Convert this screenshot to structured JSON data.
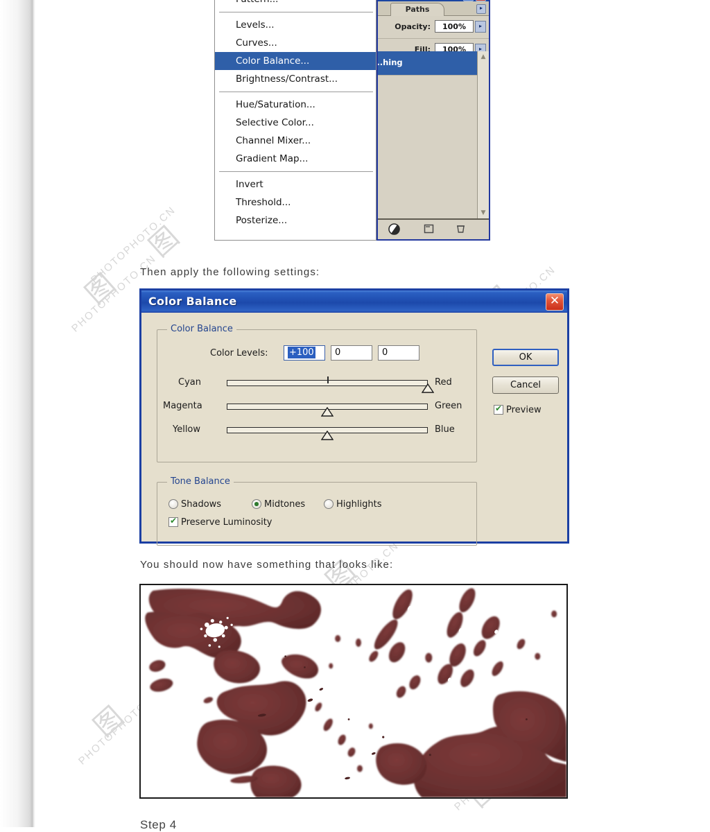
{
  "document": {
    "tutorial_steps": {
      "instruction_1": "Then apply the following settings:",
      "instruction_2": "You should now have something that looks like:",
      "next_step_heading": "Step 4"
    },
    "watermark": {
      "text": "PHOTOPHOTO.CN",
      "logo_glyph": "图"
    }
  },
  "photoshop_menu": {
    "name": "adjustment-layer-menu",
    "items": [
      {
        "label": "Pattern...",
        "selected": false,
        "separator_after": true
      },
      {
        "label": "Levels...",
        "selected": false,
        "separator_after": false
      },
      {
        "label": "Curves...",
        "selected": false,
        "separator_after": false
      },
      {
        "label": "Color Balance...",
        "selected": true,
        "separator_after": false
      },
      {
        "label": "Brightness/Contrast...",
        "selected": false,
        "separator_after": true
      },
      {
        "label": "Hue/Saturation...",
        "selected": false,
        "separator_after": false
      },
      {
        "label": "Selective Color...",
        "selected": false,
        "separator_after": false
      },
      {
        "label": "Channel Mixer...",
        "selected": false,
        "separator_after": false
      },
      {
        "label": "Gradient Map...",
        "selected": false,
        "separator_after": true
      },
      {
        "label": "Invert",
        "selected": false,
        "separator_after": false
      },
      {
        "label": "Threshold...",
        "selected": false,
        "separator_after": false
      },
      {
        "label": "Posterize...",
        "selected": false,
        "separator_after": false
      }
    ]
  },
  "layers_palette": {
    "tab_label": "Paths",
    "menu_arrow_glyph": "▸",
    "minimize_glyph": "_",
    "close_glyph": "✕",
    "opacity": {
      "label": "Opacity:",
      "value": "100%",
      "arrow_glyph": "▸"
    },
    "fill": {
      "label": "Fill:",
      "value": "100%",
      "arrow_glyph": "▸"
    },
    "selected_layer_name": "...hing",
    "scroll_up_glyph": "▲",
    "scroll_down_glyph": "▼",
    "bottom_icons": [
      "adjustment-layer-icon",
      "new-layer-icon",
      "delete-layer-icon"
    ]
  },
  "color_balance_dialog": {
    "title": "Color Balance",
    "close_glyph": "✕",
    "color_balance_group": {
      "legend": "Color Balance",
      "color_levels_label": "Color Levels:",
      "levels": [
        "+100",
        "0",
        "0"
      ],
      "sliders": [
        {
          "left": "Cyan",
          "right": "Red",
          "value": 100
        },
        {
          "left": "Magenta",
          "right": "Green",
          "value": 0
        },
        {
          "left": "Yellow",
          "right": "Blue",
          "value": 0
        }
      ]
    },
    "tone_balance_group": {
      "legend": "Tone Balance",
      "options": [
        {
          "label": "Shadows",
          "checked": false
        },
        {
          "label": "Midtones",
          "checked": true
        },
        {
          "label": "Highlights",
          "checked": false
        }
      ],
      "preserve_luminosity": {
        "label": "Preserve Luminosity",
        "checked": true
      }
    },
    "buttons": {
      "ok": "OK",
      "cancel": "Cancel",
      "preview": {
        "label": "Preview",
        "checked": true
      }
    }
  },
  "blood_image": {
    "alt": "Blood splatter result image",
    "blood_color": "#6e3232",
    "blood_color_dark": "#5c2828",
    "background_color": "#ffffff"
  },
  "colors": {
    "titlebar_blue": "#1c49ab",
    "menu_highlight": "#2f5fa8",
    "dialog_face": "#e5dfcd",
    "legend_blue": "#24458f",
    "close_red": "#c92f1b"
  }
}
